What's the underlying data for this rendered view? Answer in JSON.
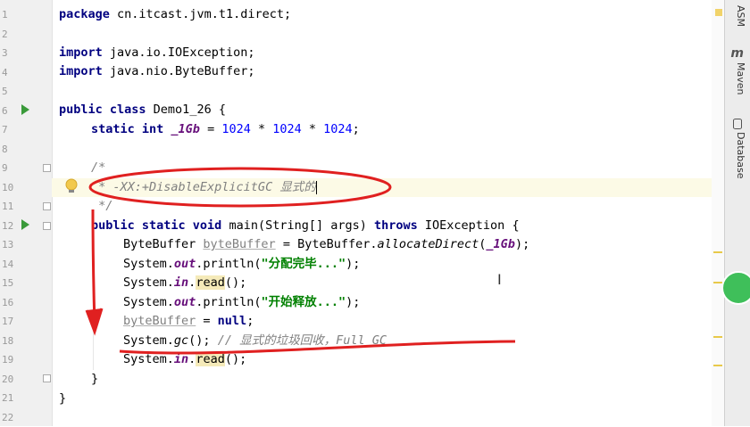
{
  "editor": {
    "line_numbers": [
      "1",
      "2",
      "3",
      "4",
      "5",
      "6",
      "7",
      "8",
      "9",
      "10",
      "11",
      "12",
      "13",
      "14",
      "15",
      "16",
      "17",
      "18",
      "19",
      "20",
      "21",
      "22"
    ],
    "lines": {
      "l1": {
        "kw": "package",
        "rest": " cn.itcast.jvm.t1.direct;"
      },
      "l3": {
        "kw": "import",
        "rest": " java.io.IOException;"
      },
      "l4": {
        "kw": "import",
        "rest": " java.nio.ByteBuffer;"
      },
      "l6": {
        "kw": "public class",
        "rest": " Demo1_26 {"
      },
      "l7": {
        "kw": "static int",
        "field": "_1Gb",
        "eq": " = ",
        "n1": "1024",
        "op1": " * ",
        "n2": "1024",
        "op2": " * ",
        "n3": "1024",
        "end": ";"
      },
      "l9": {
        "cm": "/*"
      },
      "l10": {
        "cm": " * -XX:+DisableExplicitGC 显式的"
      },
      "l11": {
        "cm": " */"
      },
      "l12": {
        "kw": "public static void",
        "mid": " main(String[] args) ",
        "kw2": "throws",
        "rest": " IOException {"
      },
      "l13": {
        "a": "ByteBuffer ",
        "var": "byteBuffer",
        "b": " = ByteBuffer.",
        "m": "allocateDirect",
        "c": "(",
        "f": "_1Gb",
        "d": ");"
      },
      "l14": {
        "a": "System.",
        "f": "out",
        "b": ".println(",
        "s": "\"分配完毕...\"",
        "c": ");"
      },
      "l15": {
        "a": "System.",
        "f": "in",
        "b": ".",
        "m": "read",
        "c": "();"
      },
      "l16": {
        "a": "System.",
        "f": "out",
        "b": ".println(",
        "s": "\"开始释放...\"",
        "c": ");"
      },
      "l17": {
        "var": "byteBuffer",
        "b": " = ",
        "kw": "null",
        "c": ";"
      },
      "l18": {
        "a": "System.",
        "m": "gc",
        "b": "(); ",
        "cm": "// 显式的垃圾回收，Full GC"
      },
      "l19": {
        "a": "System.",
        "f": "in",
        "b": ".",
        "m": "read",
        "c": "();"
      },
      "l20": {
        "t": "}"
      },
      "l21": {
        "t": "}"
      }
    }
  },
  "toolwindows": {
    "asm": "ASM",
    "maven": "Maven",
    "database": "Database",
    "maven_icon": "m"
  },
  "icons": [
    "run-gutter-icon",
    "lightbulb-icon",
    "fold-icon",
    "text-cursor-icon",
    "maven-icon",
    "database-icon"
  ],
  "colors": {
    "keyword": "#000080",
    "number": "#0000ff",
    "string": "#008000",
    "field": "#660e7a",
    "comment": "#808080",
    "annotation_red": "#e02020"
  }
}
